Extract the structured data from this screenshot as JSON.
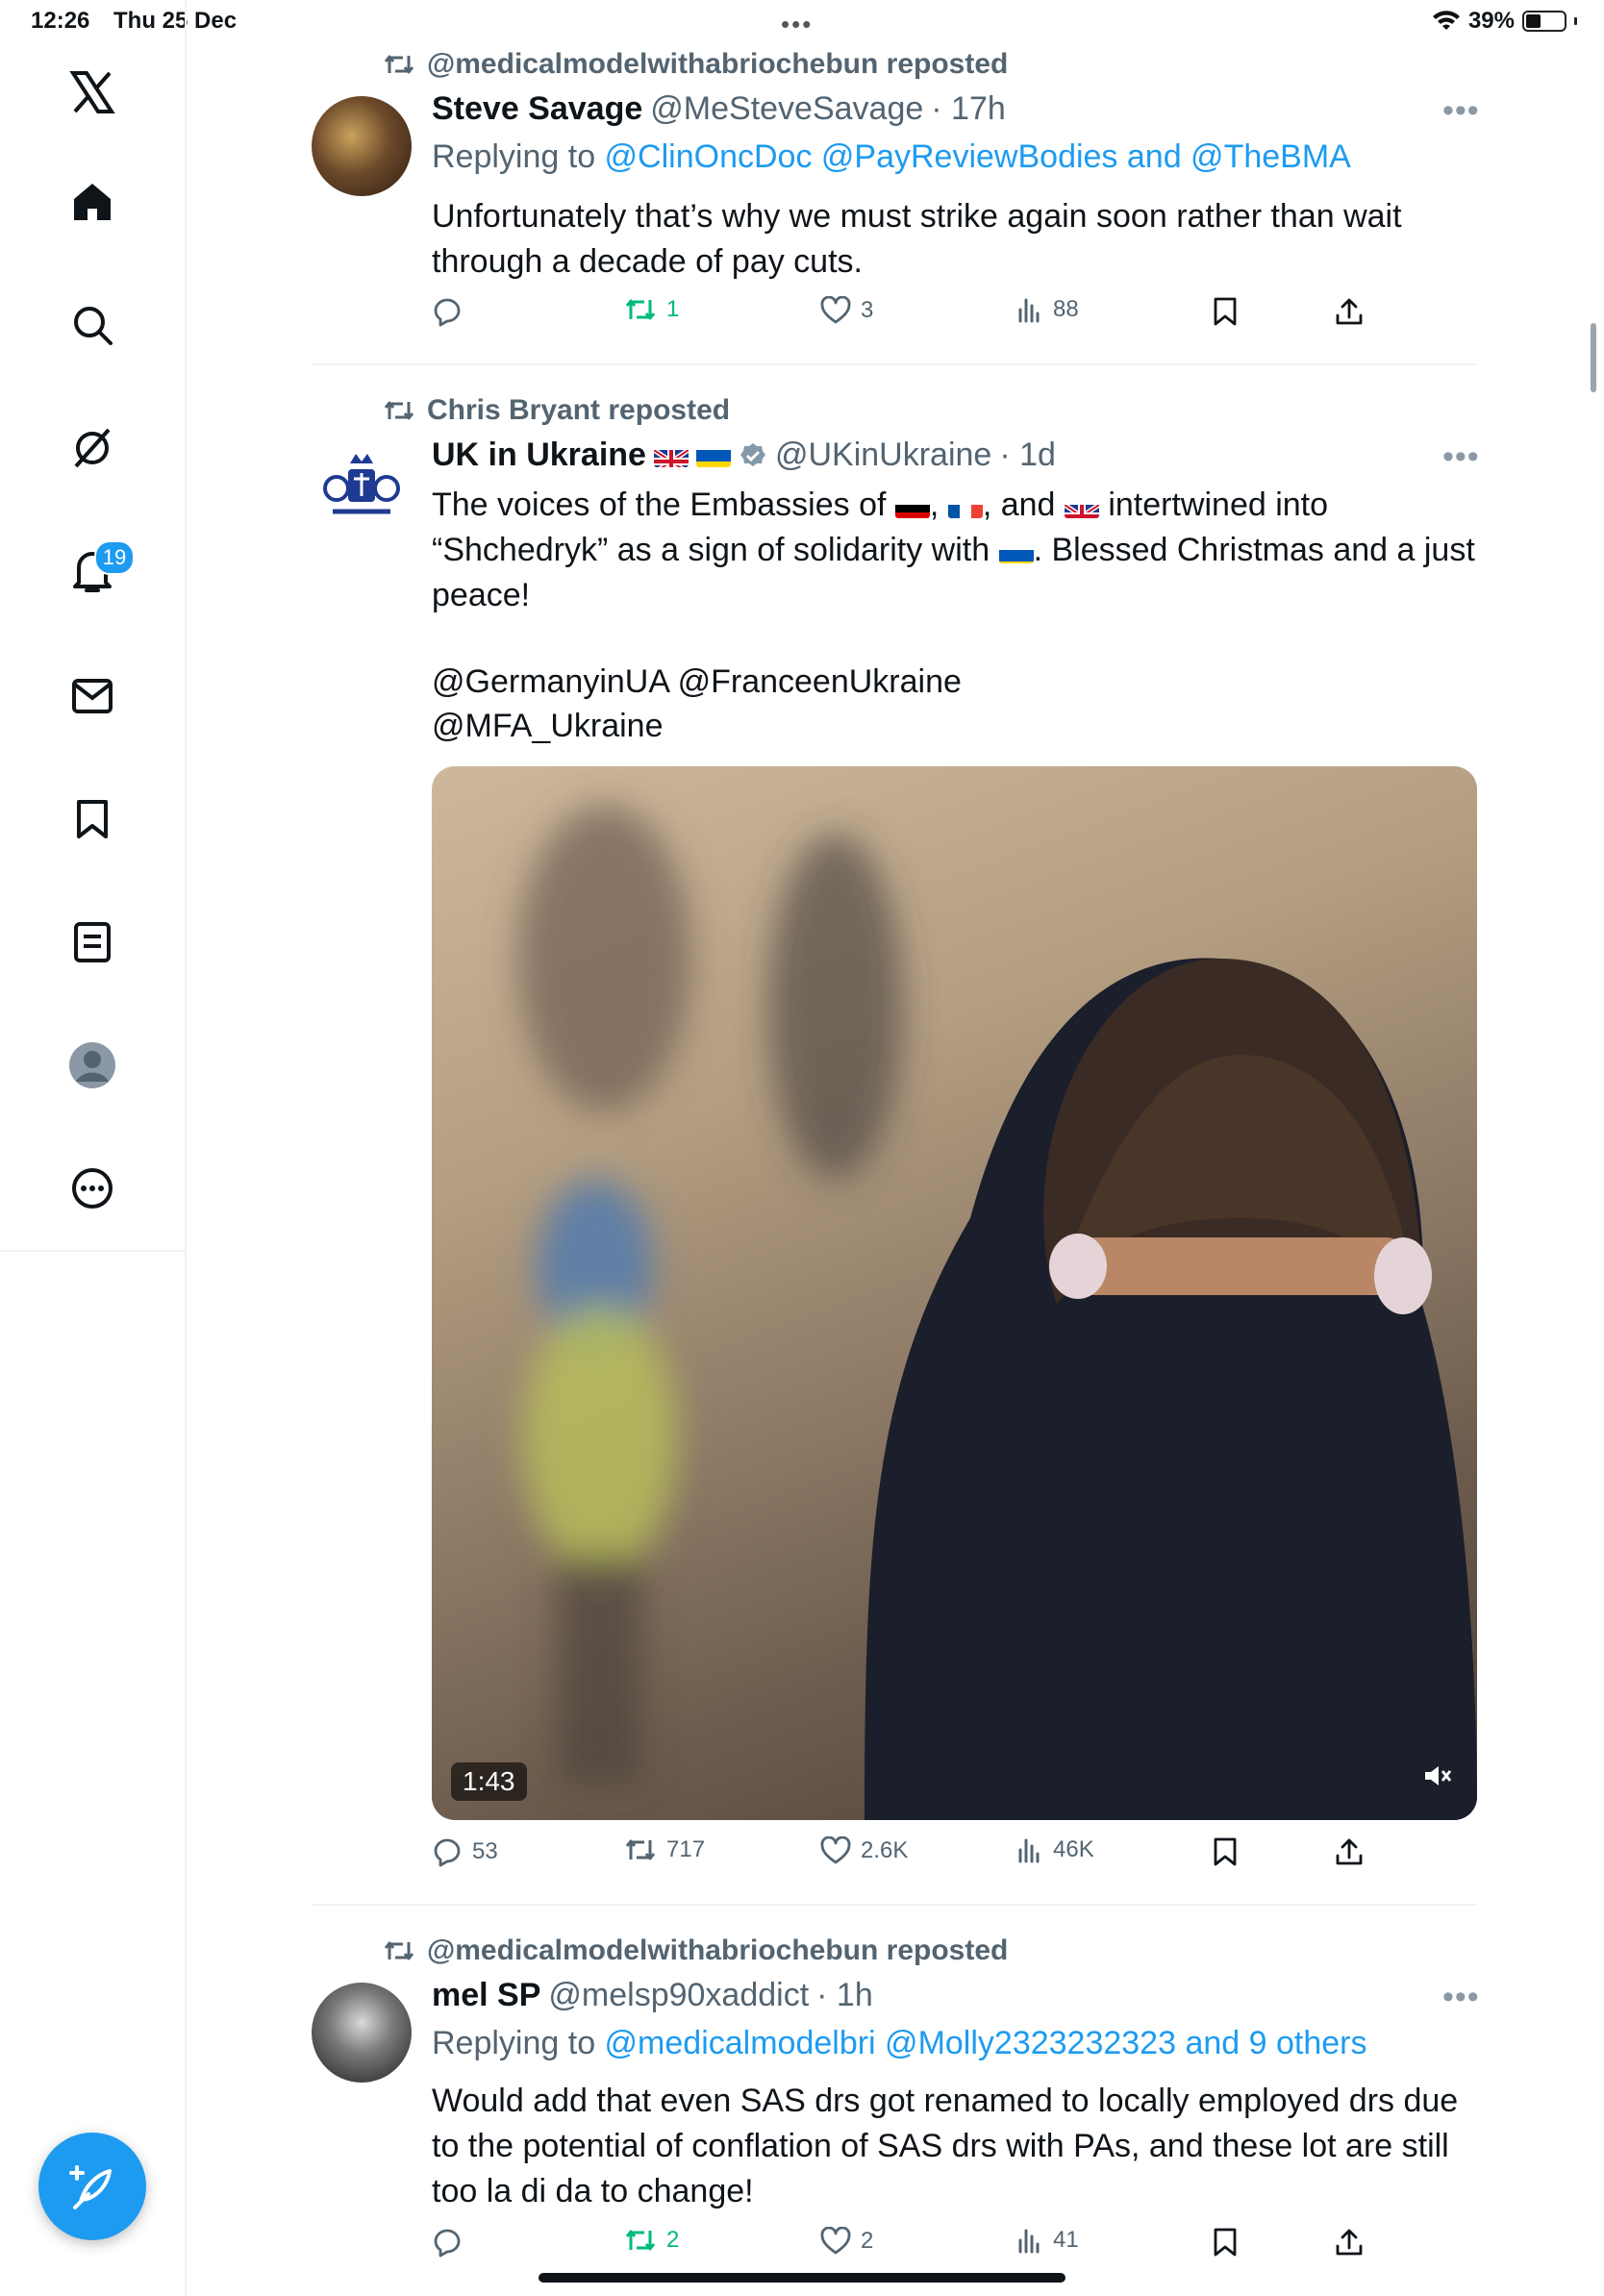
{
  "status": {
    "time": "12:26",
    "date": "Thu 25 Dec",
    "dots": "•••",
    "battery": "39%",
    "battery_level": 0.39
  },
  "sidebar": {
    "items": [
      {
        "icon": "x-logo-icon"
      },
      {
        "icon": "home-icon"
      },
      {
        "icon": "search-icon"
      },
      {
        "icon": "grok-icon"
      },
      {
        "icon": "notifications-icon"
      },
      {
        "icon": "messages-icon"
      },
      {
        "icon": "bookmarks-icon"
      },
      {
        "icon": "lists-icon"
      },
      {
        "icon": "profile-icon"
      },
      {
        "icon": "more-icon"
      }
    ],
    "notification_count": "19"
  },
  "posts": [
    {
      "repost_label": "@medicalmodelwithabriochebun reposted",
      "name": "Steve Savage",
      "handle": "@MeSteveSavage",
      "time": "· 17h",
      "replying_prefix": "Replying to ",
      "replying_to": "@ClinOncDoc @PayReviewBodies and @TheBMA",
      "text": "Unfortunately that’s why we must strike again soon rather than wait through a decade of pay cuts.",
      "replies": "",
      "reposts": "1",
      "likes": "3",
      "views": "88"
    },
    {
      "repost_label": "Chris Bryant reposted",
      "name": "UK in Ukraine",
      "handle": "@UKinUkraine",
      "time": "· 1d",
      "text_1": "The voices of the Embassies of",
      "text_2": ",",
      "text_3": ", and",
      "text_4": "intertwined into “Shchedryk” as a sign of solidarity with",
      "text_5": ". Blessed Christmas and a just peace!",
      "mentions_1": "@GermanyinUA @FranceenUkraine",
      "mentions_2": "@MFA_Ukraine",
      "video_duration": "1:43",
      "replies": "53",
      "reposts": "717",
      "likes": "2.6K",
      "views": "46K"
    },
    {
      "repost_label": "@medicalmodelwithabriochebun reposted",
      "name": "mel SP",
      "handle": "@melsp90xaddict",
      "time": "· 1h",
      "replying_prefix": "Replying to ",
      "replying_to": "@medicalmodelbri @Molly2323232323 and 9 others",
      "text": "Would add that even SAS drs got renamed to locally employed drs due to the potential of conflation of SAS drs with PAs, and these lot are still too la di da to change!",
      "replies": "",
      "reposts": "2",
      "likes": "2",
      "views": "41"
    }
  ],
  "colors": {
    "accent": "#1d9bf0",
    "repost_green": "#00ba7c",
    "secondary": "#536471"
  }
}
